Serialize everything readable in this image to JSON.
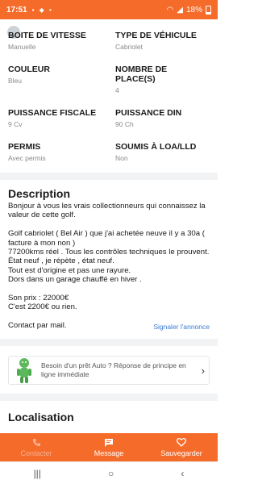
{
  "status_bar": {
    "time": "17:51",
    "battery": "18%"
  },
  "specs": [
    {
      "label": "BOITE DE VITESSE",
      "value": "Manuelle"
    },
    {
      "label": "TYPE DE VÉHICULE",
      "value": "Cabriolet"
    },
    {
      "label": "COULEUR",
      "value": "Bleu"
    },
    {
      "label": "NOMBRE DE PLACE(S)",
      "value": "4"
    },
    {
      "label": "PUISSANCE FISCALE",
      "value": "9 Cv"
    },
    {
      "label": "PUISSANCE DIN",
      "value": "90 Ch"
    },
    {
      "label": "PERMIS",
      "value": "Avec permis"
    },
    {
      "label": "SOUMIS À LOA/LLD",
      "value": "Non"
    }
  ],
  "description": {
    "title": "Description",
    "body": "Bonjour à vous les vrais collectionneurs qui connaissez la valeur de cette golf.\n\nGolf cabriolet ( Bel Air ) que j'ai achetée neuve il y a 30a ( facture à mon non )\n77200kms réel . Tous les contrôles techniques le prouvent.\nÉtat neuf , je répète , état neuf.\nTout est d'origine et pas une rayure.\nDors dans un garage chauffé en hiver .\n\nSon prix : 22000€\nC'est 2200€ ou rien.\n\nContact par mail.",
    "report_link": "Signaler l'annonce"
  },
  "loan_banner": {
    "text": "Besoin d'un prêt Auto ? Réponse de principe en ligne immédiate"
  },
  "location": {
    "title": "Localisation"
  },
  "bottom_actions": {
    "contact": "Contacter",
    "message": "Message",
    "save": "Sauvegarder"
  },
  "colors": {
    "brand": "#f56b2a",
    "link": "#3a7bd5"
  }
}
